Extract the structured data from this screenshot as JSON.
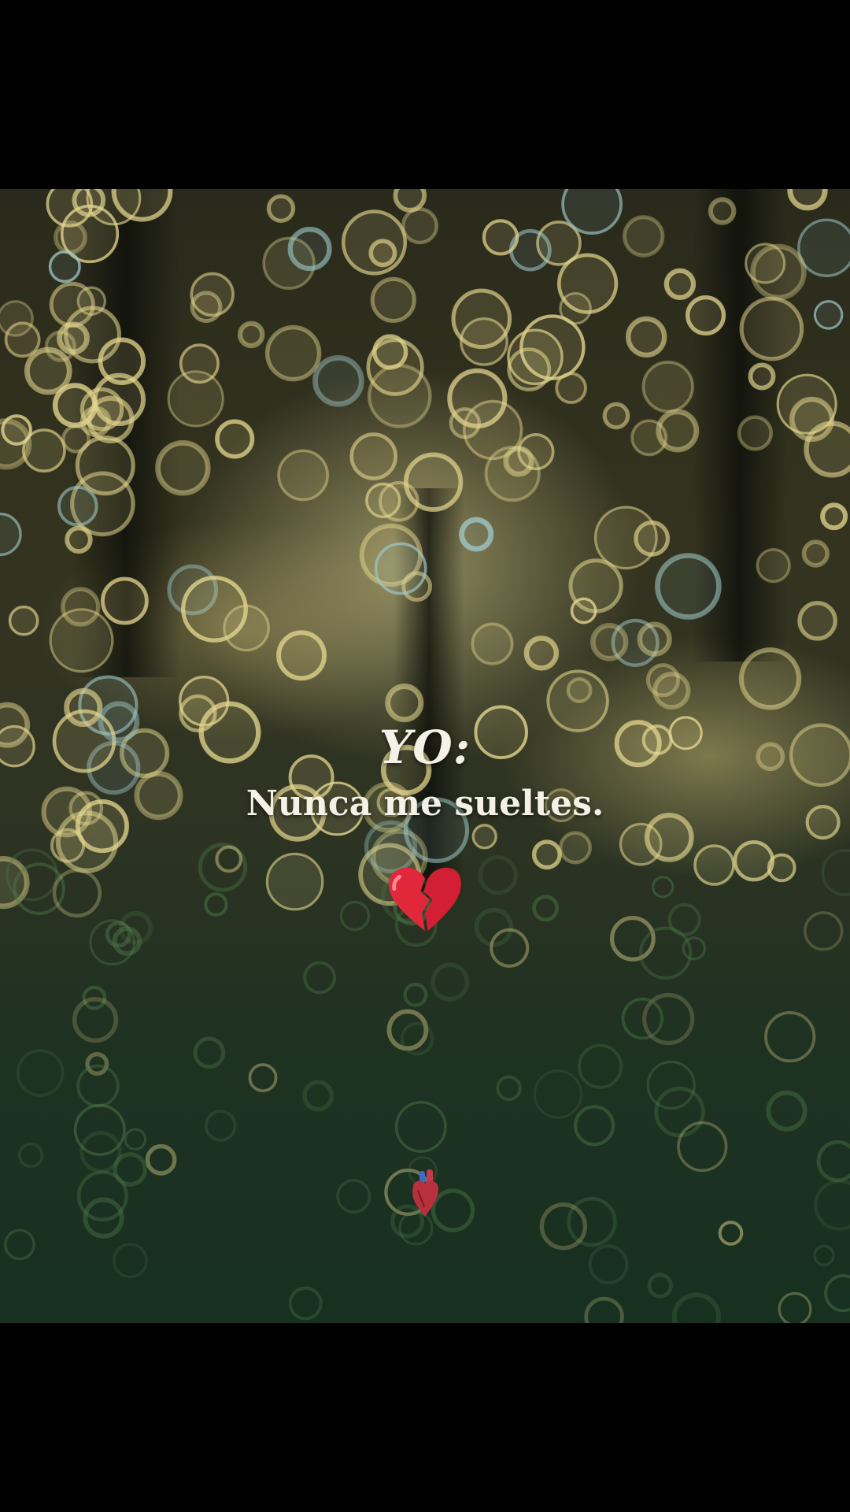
{
  "caption": {
    "speaker": "YO:",
    "line": "Nunca me sueltes."
  },
  "emojis": {
    "broken_heart": "💔",
    "anatomical_heart": "🫀"
  },
  "colors": {
    "letterbox": "#000000",
    "caption_text": "#f4f1e6",
    "bokeh_warm": "#e3d68e",
    "bokeh_cool": "#9fc8c8",
    "grass": "#1f3a22"
  }
}
